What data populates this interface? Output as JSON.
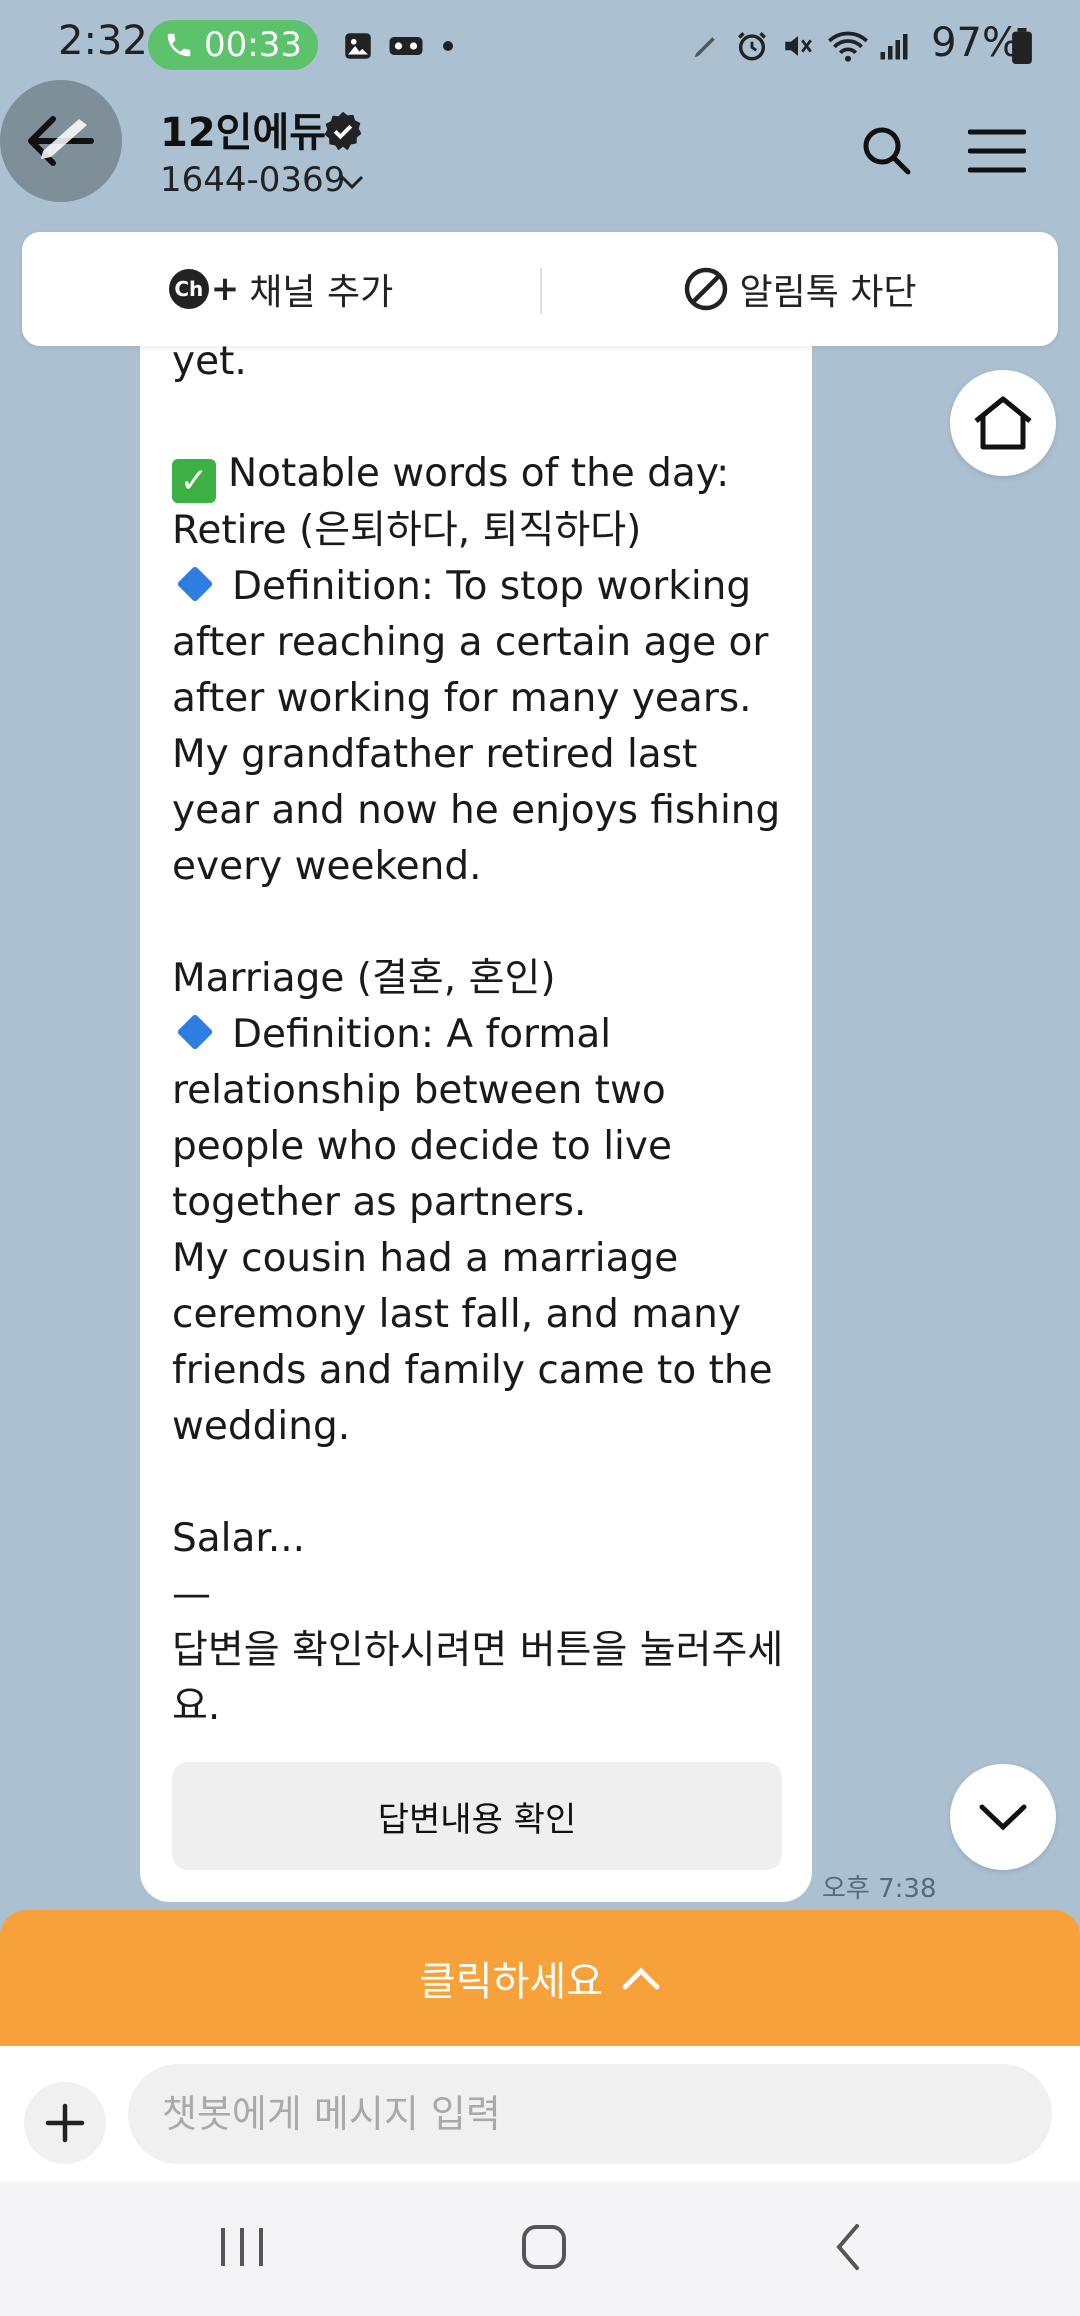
{
  "status_bar": {
    "time": "2:32",
    "call_timer": "00:33",
    "battery": "97%"
  },
  "header": {
    "title": "12인에듀",
    "phone": "1644-0369"
  },
  "channel_bar": {
    "add_channel": "채널 추가",
    "add_channel_badge": "Ch",
    "block_alerts": "알림톡 차단"
  },
  "message": {
    "lines": [
      "yet.",
      "",
      "Notable words of the day:",
      "Retire (은퇴하다, 퇴직하다)",
      "Definition: To stop working after reaching a certain age or after working for many years.",
      "My grandfather retired last year and now he enjoys fishing every weekend.",
      "",
      "Marriage (결혼, 혼인)",
      "Definition: A formal relationship between two people who decide to live together as partners.",
      "My cousin had a marriage ceremony last fall, and many friends and family came to the wedding.",
      "",
      "Salar...",
      "—",
      "답변을 확인하시려면 버튼을 눌러주세요."
    ],
    "answer_button": "답변내용 확인",
    "time": "오후 7:38"
  },
  "banner": {
    "label": "클릭하세요"
  },
  "input": {
    "placeholder": "챗봇에게 메시지 입력"
  },
  "colors": {
    "chat_bg": "#abc1d1",
    "banner": "#f7a13a",
    "call_pill": "#5cc36c"
  },
  "icons": [
    "back-arrow-icon",
    "verified-icon",
    "search-icon",
    "menu-icon",
    "home-icon",
    "chevron-down-icon",
    "chevron-up-icon",
    "plus-icon",
    "block-icon",
    "check-icon",
    "diamond-icon",
    "recents-icon",
    "home-nav-icon",
    "back-nav-icon"
  ]
}
